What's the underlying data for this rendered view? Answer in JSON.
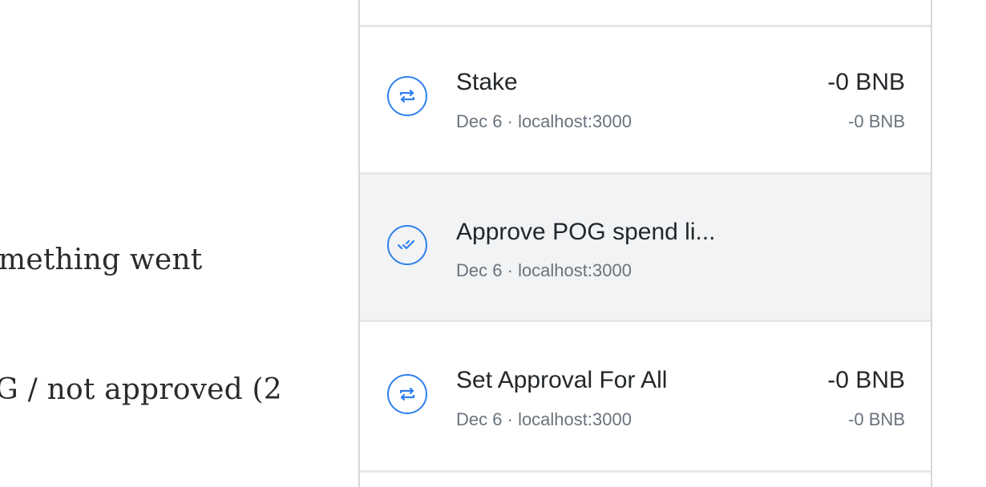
{
  "background": {
    "line1": "mething went",
    "line2": "G / not approved (2"
  },
  "activity": {
    "items": [
      {
        "title": "Stake",
        "date": "Dec 6",
        "separator": "·",
        "origin": "localhost:3000",
        "amount": "-0 BNB",
        "secondary_amount": "-0 BNB",
        "icon": "swap-arrows-icon"
      },
      {
        "title": "Approve POG spend li...",
        "date": "Dec 6",
        "separator": "·",
        "origin": "localhost:3000",
        "icon": "double-check-icon"
      },
      {
        "title": "Set Approval For All",
        "date": "Dec 6",
        "separator": "·",
        "origin": "localhost:3000",
        "amount": "-0 BNB",
        "secondary_amount": "-0 BNB",
        "icon": "swap-arrows-icon"
      }
    ]
  },
  "colors": {
    "accent": "#2f80ed",
    "text_primary": "#24272a",
    "text_secondary": "#6a737d",
    "divider": "#e4e6e8",
    "highlight_bg": "#f2f3f4"
  }
}
